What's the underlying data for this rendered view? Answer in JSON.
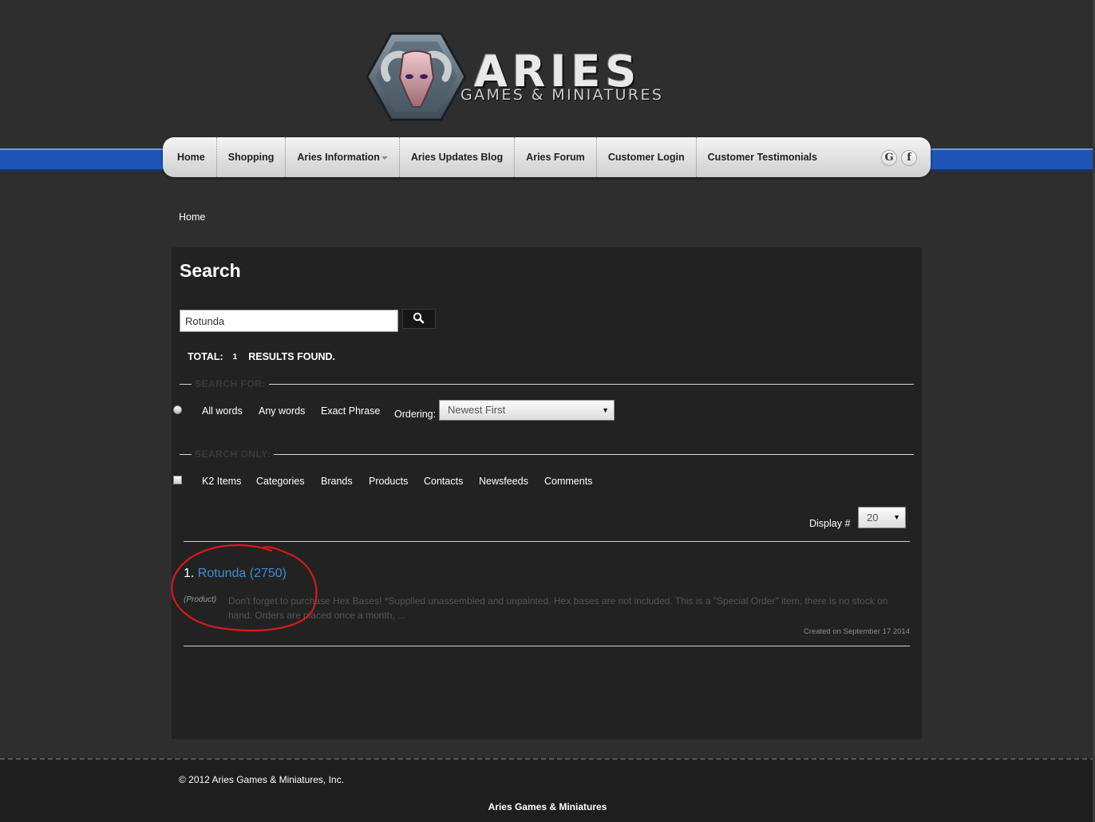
{
  "logo": {
    "title": "ARIES",
    "subtitle": "GAMES & MINIATURES"
  },
  "nav": {
    "items": [
      {
        "label": "Home",
        "dropdown": false
      },
      {
        "label": "Shopping",
        "dropdown": false
      },
      {
        "label": "Aries Information",
        "dropdown": true
      },
      {
        "label": "Aries Updates Blog",
        "dropdown": false
      },
      {
        "label": "Aries Forum",
        "dropdown": false
      },
      {
        "label": "Customer Login",
        "dropdown": false
      },
      {
        "label": "Customer Testimonials",
        "dropdown": false
      }
    ],
    "social": [
      {
        "icon": "google-icon",
        "glyph": "G"
      },
      {
        "icon": "facebook-icon",
        "glyph": "f"
      }
    ]
  },
  "breadcrumb": "Home",
  "search": {
    "title": "Search",
    "query": "Rotunda",
    "total_label": "TOTAL:",
    "total_count": "1",
    "results_label": "RESULTS FOUND.",
    "search_for_legend": "SEARCH FOR:",
    "match_options": [
      "All words",
      "Any words",
      "Exact Phrase"
    ],
    "ordering_label": "Ordering:",
    "ordering_value": "Newest First",
    "search_only_legend": "SEARCH ONLY:",
    "areas": [
      "K2 Items",
      "Categories",
      "Brands",
      "Products",
      "Contacts",
      "Newsfeeds",
      "Comments"
    ],
    "display_label": "Display #",
    "display_value": "20"
  },
  "result": {
    "index": "1.",
    "title": "Rotunda (2750)",
    "category": "(Product)",
    "text": "Don't forget to purchase Hex Bases! *Supplied unassembled and unpainted. Hex bases are not included. This is a \"Special Order\" item, there is no stock on hand. Orders are placed once a month, ...",
    "created": "Created on September 17 2014"
  },
  "colors": {
    "accent_blue": "#1f56b6",
    "link": "#3c8fd6",
    "annotation": "#d8181b"
  },
  "footer": {
    "copyright": "© 2012 Aries Games & Miniatures, Inc.",
    "name": "Aries Games & Miniatures"
  }
}
